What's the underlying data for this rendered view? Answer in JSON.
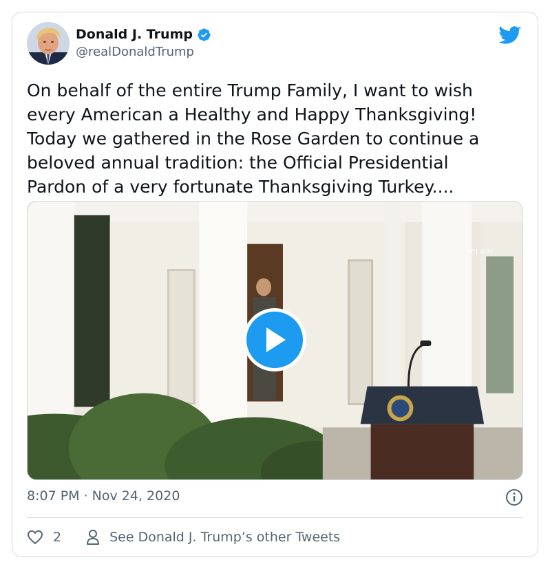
{
  "author": {
    "name": "Donald J. Trump",
    "handle": "@realDonaldTrump",
    "verified": true
  },
  "tweet": {
    "text": "On behalf of the entire Trump Family, I want to wish\nevery American a Healthy and Happy Thanksgiving!\nToday we gathered in the Rose Garden to continue a\nbeloved annual tradition: the Official Presidential\nPardon of a very fortunate Thanksgiving Turkey....",
    "timestamp": "8:07 PM · Nov 24, 2020"
  },
  "media": {
    "type": "video",
    "watermark": "WH.GOV"
  },
  "actions": {
    "likes": "2",
    "other_tweets_label": "See Donald J. Trump’s other Tweets"
  },
  "colors": {
    "accent": "#1d9bf0",
    "text": "#0f1419",
    "muted": "#536471"
  },
  "icons": {
    "brand": "twitter-bird-icon",
    "verified": "verified-badge-icon",
    "play": "play-icon",
    "info": "info-icon",
    "like": "heart-icon",
    "profile": "person-icon"
  }
}
